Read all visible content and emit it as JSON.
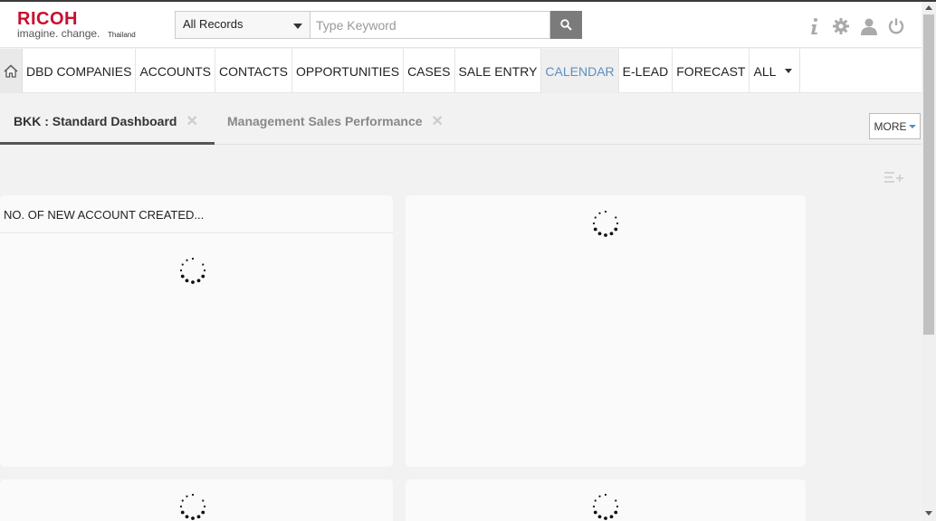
{
  "header": {
    "logo": {
      "brand": "RICOH",
      "tagline": "imagine. change.",
      "region": "Thailand",
      "brand_color": "#c8102e"
    },
    "search": {
      "scope_selected": "All Records",
      "placeholder": "Type Keyword"
    },
    "icons": [
      "search-icon",
      "info-icon",
      "gear-icon",
      "user-icon",
      "power-icon"
    ]
  },
  "nav": {
    "home_icon": "home-icon",
    "items": [
      {
        "label": "DBD COMPANIES"
      },
      {
        "label": "ACCOUNTS"
      },
      {
        "label": "CONTACTS"
      },
      {
        "label": "OPPORTUNITIES"
      },
      {
        "label": "CASES"
      },
      {
        "label": "SALE ENTRY"
      },
      {
        "label": "CALENDAR",
        "active": true
      },
      {
        "label": "E-LEAD"
      },
      {
        "label": "FORECAST"
      },
      {
        "label": "ALL",
        "dropdown": true
      }
    ],
    "active_color": "#5b8fc2"
  },
  "tabs": {
    "items": [
      {
        "label": "BKK : Standard Dashboard"
      },
      {
        "label": "Management Sales Performance"
      }
    ],
    "more_label": "MORE"
  },
  "dashlets": [
    {
      "title": "NO. OF NEW ACCOUNT CREATED..."
    }
  ]
}
